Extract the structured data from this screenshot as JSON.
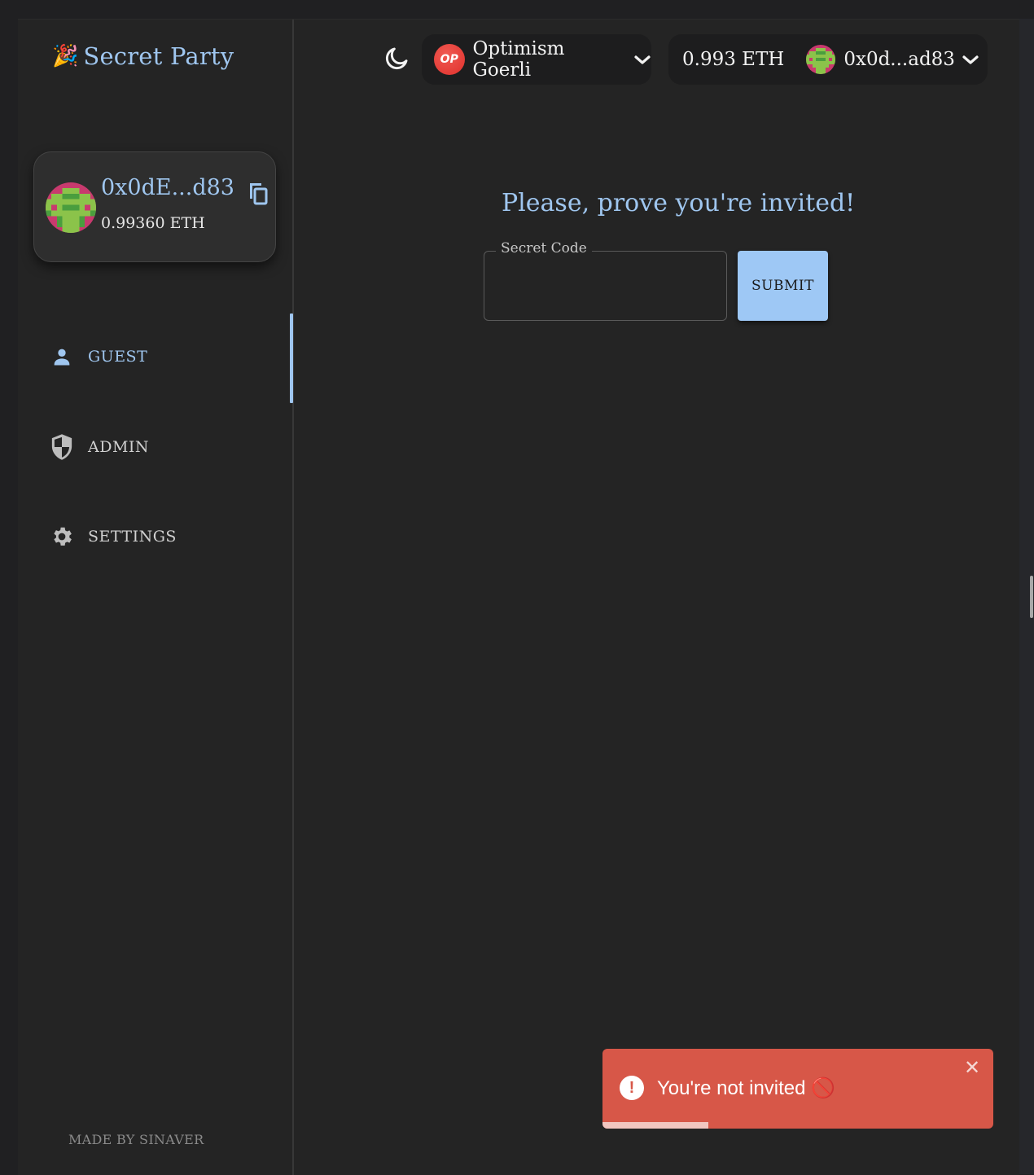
{
  "app": {
    "logo_emoji": "🎉",
    "title": "Secret Party"
  },
  "sidebar": {
    "account": {
      "address": "0x0dE...d83",
      "balance": "0.99360 ETH"
    },
    "items": [
      {
        "label": "GUEST",
        "icon": "person-icon",
        "active": true
      },
      {
        "label": "ADMIN",
        "icon": "shield-icon",
        "active": false
      },
      {
        "label": "SETTINGS",
        "icon": "gear-icon",
        "active": false
      }
    ],
    "footer": "MADE BY SINAVER"
  },
  "header": {
    "theme_icon": "moon-icon",
    "network": {
      "badge": "OP",
      "name": "Optimism Goerli"
    },
    "wallet": {
      "balance": "0.993 ETH",
      "address": "0x0d...ad83"
    }
  },
  "main": {
    "heading": "Please, prove you're invited!",
    "secret_code": {
      "label": "Secret Code",
      "value": "",
      "placeholder": ""
    },
    "submit_label": "SUBMIT"
  },
  "toast": {
    "type": "error",
    "message": "You're not invited 🚫",
    "close": "✕",
    "progress_percent": 27,
    "color": "#d75748"
  },
  "colors": {
    "accent": "#9fc6ef",
    "background": "#242424",
    "error": "#d75748",
    "op_red": "#ea3431"
  }
}
